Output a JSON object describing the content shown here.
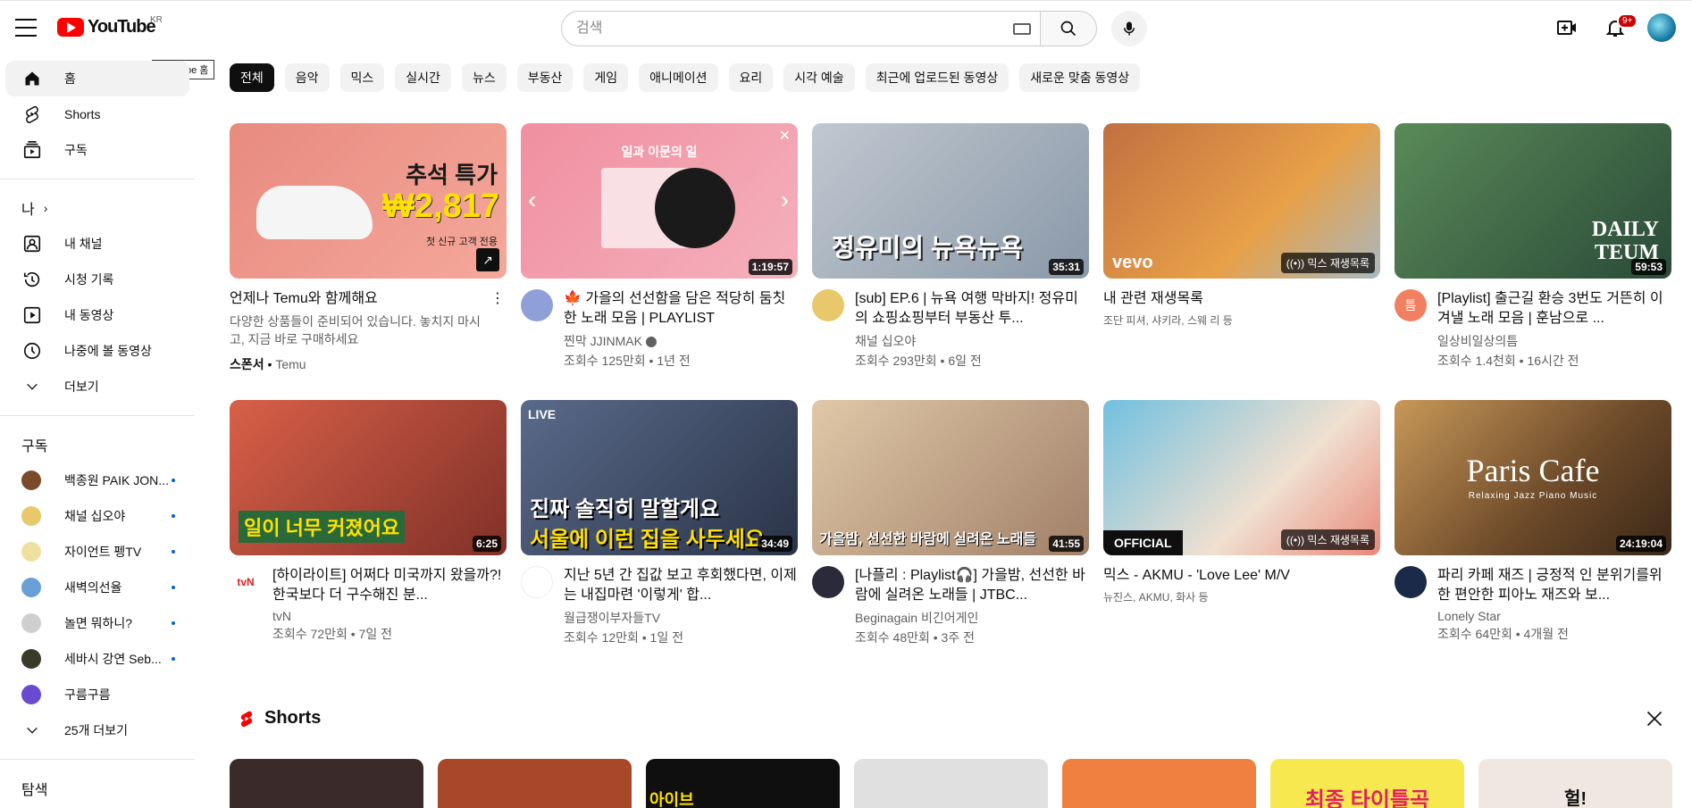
{
  "header": {
    "logo_text": "YouTube",
    "logo_cc": "KR",
    "search_placeholder": "검색",
    "notif_count": "9+"
  },
  "tooltip": "YouTube 홈",
  "sidebar": {
    "main": [
      {
        "label": "홈",
        "icon": "home-icon"
      },
      {
        "label": "Shorts",
        "icon": "shorts-icon"
      },
      {
        "label": "구독",
        "icon": "subscriptions-icon"
      }
    ],
    "me_label": "나",
    "me_items": [
      {
        "label": "내 채널",
        "icon": "channel-icon"
      },
      {
        "label": "시청 기록",
        "icon": "history-icon"
      },
      {
        "label": "내 동영상",
        "icon": "videos-icon"
      },
      {
        "label": "나중에 볼 동영상",
        "icon": "watch-later-icon"
      },
      {
        "label": "더보기",
        "icon": "chevron-down-icon"
      }
    ],
    "subs_label": "구독",
    "subs": [
      {
        "label": "백종원 PAIK JON...",
        "color": "#7a4a2a"
      },
      {
        "label": "채널 십오야",
        "color": "#e8c86a"
      },
      {
        "label": "자이언트 펭TV",
        "color": "#f0e0a0"
      },
      {
        "label": "새벽의선율",
        "color": "#6aa0d8"
      },
      {
        "label": "놀면 뭐하니?",
        "color": "#cfcfcf"
      },
      {
        "label": "세바시 강연 Seb...",
        "color": "#3a3a2a"
      },
      {
        "label": "구름구름",
        "color": "#6a4ad0"
      }
    ],
    "more_subs": "25개 더보기",
    "explore_label": "탐색"
  },
  "chips": [
    "전체",
    "음악",
    "믹스",
    "실시간",
    "뉴스",
    "부동산",
    "게임",
    "애니메이션",
    "요리",
    "시각 예술",
    "최근에 업로드된 동영상",
    "새로운 맞춤 동영상"
  ],
  "videos": [
    {
      "kind": "ad",
      "title": "언제나 Temu와 함께해요",
      "desc": "다양한 상품들이 준비되어 있습니다. 놓치지 마시고, 지금 바로 구매하세요",
      "sponsor": "스폰서",
      "advertiser": "Temu",
      "thumb_text_1": "추석 특가",
      "thumb_text_2": "₩2,817",
      "thumb_text_3": "첫 신규 고객 전용",
      "bg": "#f08080"
    },
    {
      "kind": "video",
      "title": "🍁 가을의 선선함을 담은 적당히 둠칫한 노래 모음 | PLAYLIST",
      "channel": "찐막 JJINMAK",
      "stats": "조회수 125만회 • 1년 전",
      "duration": "1:19:57",
      "thumb_text_1": "일과 이문의 일",
      "bg": "#f098a8",
      "avatar_color": "#8fa0d8"
    },
    {
      "kind": "video",
      "title": "[sub] EP.6 | 뉴욕 여행 막바지! 정유미의 쇼핑쇼핑부터 부동산 투...",
      "channel": "채널 십오야",
      "stats": "조회수 293만회 • 6일 전",
      "duration": "35:31",
      "thumb_text_1": "정유미의 뉴욕뉴욕",
      "bg": "#9ab0c8",
      "avatar_color": "#e8c86a"
    },
    {
      "kind": "mix",
      "title": "내 관련 재생목록",
      "sub": "조단 피셔, 샤키라, 스웨 리 등",
      "badge": "믹스 재생목록",
      "thumb_text_1": "vevo",
      "bg": "#e89a48"
    },
    {
      "kind": "video",
      "title": "[Playlist] 출근길 환승 3번도 거뜬히 이겨낼 노래 모음 | 훈남으로 ...",
      "channel": "일상비일상의틈",
      "stats": "조회수 1.4천회 • 16시간 전",
      "duration": "59:53",
      "thumb_text_1": "DAILY TEUM",
      "bg": "#3a6a48",
      "avatar_color": "#f08060",
      "avatar_letter": "틈"
    },
    {
      "kind": "video",
      "title": "[하이라이트] 어쩌다 미국까지 왔을까?! 한국보다 더 구수해진 분...",
      "channel": "tvN",
      "stats": "조회수 72만회 • 7일 전",
      "duration": "6:25",
      "thumb_text_1": "일이 너무 커졌어요",
      "bg": "#b84838",
      "avatar_color": "#ffffff",
      "avatar_letter": "tvN"
    },
    {
      "kind": "video",
      "title": "지난 5년 간 집값 보고 후회했다면, 이제는 내집마련 '이렇게' 합...",
      "channel": "월급쟁이부자들TV",
      "stats": "조회수 12만회 • 1일 전",
      "duration": "34:49",
      "thumb_text_1": "진짜 솔직히 말할게요",
      "thumb_text_2": "서울에 이런 집을 사두세요",
      "live": "LIVE",
      "bg": "#384868",
      "avatar_color": "#ffffff"
    },
    {
      "kind": "video",
      "title": "[나플리 : Playlist🎧] 가을밤, 선선한 바람에 실려온 노래들 | JTBC...",
      "channel": "Beginagain 비긴어게인",
      "stats": "조회수 48만회 • 3주 전",
      "duration": "41:55",
      "thumb_text_1": "가을밤, 선선한 바람에 실려온 노래들",
      "bg": "#c8a888",
      "avatar_color": "#2a2a3a"
    },
    {
      "kind": "mix",
      "title": "믹스 - AKMU - 'Love Lee' M/V",
      "sub": "뉴진스, AKMU, 화사 등",
      "badge": "믹스 재생목록",
      "thumb_text_1": "OFFICIAL",
      "bg": "#58a8c8"
    },
    {
      "kind": "video",
      "title": "파리 카페 재즈 | 긍정적 인 분위기를위한 편안한 피아노 재즈와 보...",
      "channel": "Lonely Star",
      "stats": "조회수 64만회 • 4개월 전",
      "duration": "24:19:04",
      "thumb_text_1": "Paris Cafe",
      "thumb_text_2": "Relaxing Jazz Piano Music",
      "bg": "#7a5a38",
      "avatar_color": "#1a2a48"
    }
  ],
  "shorts": {
    "label": "Shorts",
    "items": [
      {
        "bg": "#3a2a2a",
        "text": ""
      },
      {
        "bg": "#a84828",
        "text": ""
      },
      {
        "bg": "#0f0f0f",
        "text": "아이브"
      },
      {
        "bg": "#e0e0e0",
        "text": ""
      },
      {
        "bg": "#f08040",
        "text": ""
      },
      {
        "bg": "#f8e850",
        "text": "최종 타이틀곡"
      },
      {
        "bg": "#f0e8e0",
        "text": "헐!"
      }
    ]
  }
}
